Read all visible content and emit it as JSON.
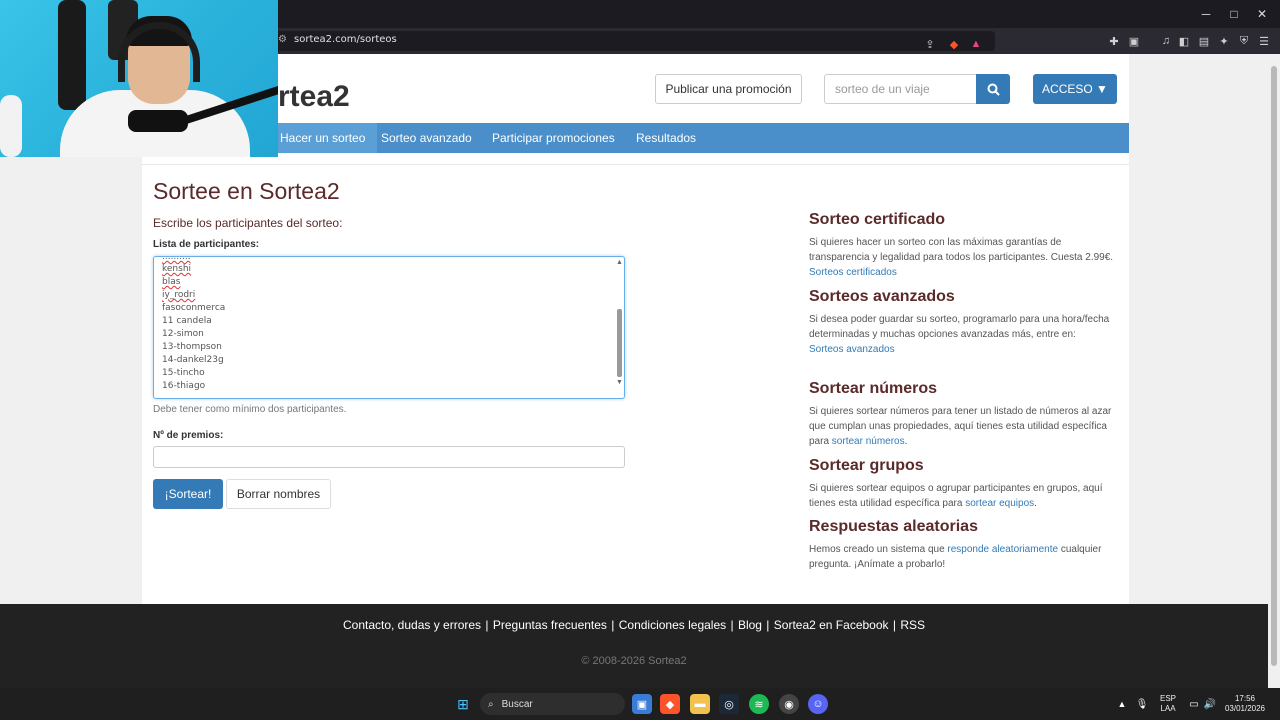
{
  "browser": {
    "url": "sortea2.com/sorteos",
    "window_controls": [
      "minimize",
      "maximize",
      "close"
    ]
  },
  "site": {
    "logo": "rtea2",
    "publish_button": "Publicar una promoción",
    "search_placeholder": "sorteo de un viaje",
    "access_button": "ACCESO ▼"
  },
  "nav": {
    "items": [
      {
        "label": "Hacer un sorteo",
        "active": true
      },
      {
        "label": "Sorteo avanzado",
        "active": false
      },
      {
        "label": "Participar promociones",
        "active": false
      },
      {
        "label": "Resultados",
        "active": false
      }
    ]
  },
  "main": {
    "title": "Sortee en Sortea2",
    "subtitle": "Escribe los participantes del sorteo:",
    "participants_label": "Lista de participantes:",
    "participants": [
      "kenshi",
      "blas",
      "iy_rodri",
      "fasoconmerca",
      "11 candela",
      "12-simon",
      "13-thompson",
      "14-dankel23g",
      "15-tincho",
      "16-thiago"
    ],
    "help_text": "Debe tener como mínimo dos participantes.",
    "prizes_label": "Nº de premios:",
    "prizes_value": "",
    "draw_button": "¡Sortear!",
    "clear_button": "Borrar nombres"
  },
  "sidebar": {
    "sections": [
      {
        "title": "Sorteo certificado",
        "text": "Si quieres hacer un sorteo con las máximas garantías de transparencia y legalidad para todos los participantes. Cuesta 2.99€.",
        "link": "Sorteos certificados",
        "tail": ""
      },
      {
        "title": "Sorteos avanzados",
        "text": "Si desea poder guardar su sorteo, programarlo para una hora/fecha determinadas y muchas opciones avanzadas más, entre en:",
        "link": "Sorteos avanzados",
        "tail": ""
      },
      {
        "title": "Sortear números",
        "text": "Si quieres sortear números para tener un listado de números al azar que cumplan unas propiedades, aquí tienes esta utilidad específica para",
        "link": "sortear números",
        "tail": "."
      },
      {
        "title": "Sortear grupos",
        "text": "Si quieres sortear equipos o agrupar participantes en grupos, aquí tienes esta utilidad específica para",
        "link": "sortear equipos",
        "tail": "."
      },
      {
        "title": "Respuestas aleatorias",
        "text": "Hemos creado un sistema que",
        "link": "responde aleatoriamente",
        "tail": " cualquier pregunta. ¡Anímate a probarlo!"
      }
    ]
  },
  "footer": {
    "links": [
      "Contacto, dudas y errores",
      "Preguntas frecuentes",
      "Condiciones legales",
      "Blog",
      "Sortea2 en Facebook",
      "RSS"
    ],
    "copyright": "© 2008-2026 Sortea2"
  },
  "taskbar": {
    "search_label": "Buscar",
    "language": "ESP",
    "layout": "LAA",
    "time": "17:56",
    "date": "03/01/2026"
  },
  "colors": {
    "primary": "#337ab7",
    "navbar": "#4a8fca",
    "heading": "#5b2a2a",
    "footer": "#222222"
  }
}
